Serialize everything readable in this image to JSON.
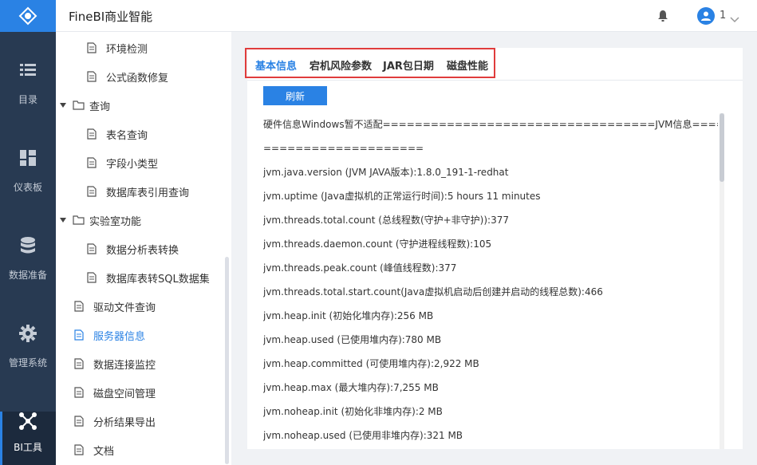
{
  "app": {
    "title": "FineBI商业智能"
  },
  "user": {
    "name": "1"
  },
  "rail": {
    "items": [
      {
        "label": "目录",
        "icon": "list-icon"
      },
      {
        "label": "仪表板",
        "icon": "dashboard-icon"
      },
      {
        "label": "数据准备",
        "icon": "database-icon"
      },
      {
        "label": "管理系统",
        "icon": "gear-icon"
      },
      {
        "label": "BI工具",
        "icon": "network-icon",
        "active": true
      }
    ]
  },
  "tree": {
    "items": [
      {
        "label": "环境检测",
        "level": 2,
        "type": "file"
      },
      {
        "label": "公式函数修复",
        "level": 2,
        "type": "file"
      },
      {
        "label": "查询",
        "level": 1,
        "type": "folder",
        "expanded": true
      },
      {
        "label": "表名查询",
        "level": 2,
        "type": "file"
      },
      {
        "label": "字段小类型",
        "level": 2,
        "type": "file"
      },
      {
        "label": "数据库表引用查询",
        "level": 2,
        "type": "file"
      },
      {
        "label": "实验室功能",
        "level": 1,
        "type": "folder",
        "expanded": true
      },
      {
        "label": "数据分析表转换",
        "level": 2,
        "type": "file"
      },
      {
        "label": "数据库表转SQL数据集",
        "level": 2,
        "type": "file"
      },
      {
        "label": "驱动文件查询",
        "level": 1,
        "type": "file"
      },
      {
        "label": "服务器信息",
        "level": 1,
        "type": "file",
        "active": true
      },
      {
        "label": "数据连接监控",
        "level": 1,
        "type": "file"
      },
      {
        "label": "磁盘空间管理",
        "level": 1,
        "type": "file"
      },
      {
        "label": "分析结果导出",
        "level": 1,
        "type": "file"
      },
      {
        "label": "文档",
        "level": 1,
        "type": "file"
      }
    ]
  },
  "tabs": [
    {
      "label": "基本信息",
      "active": true
    },
    {
      "label": "宕机风险参数"
    },
    {
      "label": "JAR包日期"
    },
    {
      "label": "磁盘性能"
    }
  ],
  "refresh_label": "刷新",
  "info_lines": [
    "硬件信息Windows暂不适配==================================JVM信息==================",
    "====================",
    "jvm.java.version (JVM JAVA版本):1.8.0_191-1-redhat",
    "jvm.uptime (Java虚拟机的正常运行时间):5 hours 11 minutes",
    "jvm.threads.total.count (总线程数(守护+非守护)):377",
    "jvm.threads.daemon.count (守护进程线程数):105",
    "jvm.threads.peak.count (峰值线程数):377",
    "jvm.threads.total.start.count(Java虚拟机启动后创建并启动的线程总数):466",
    "jvm.heap.init (初始化堆内存):256 MB",
    "jvm.heap.used (已使用堆内存):780 MB",
    "jvm.heap.committed (可使用堆内存):2,922 MB",
    "jvm.heap.max (最大堆内存):7,255 MB",
    "jvm.noheap.init (初始化非堆内存):2 MB",
    "jvm.noheap.used (已使用非堆内存):321 MB"
  ],
  "colors": {
    "accent": "#2a82e4",
    "rail_bg": "#283a52",
    "highlight": "#e03c3c"
  }
}
